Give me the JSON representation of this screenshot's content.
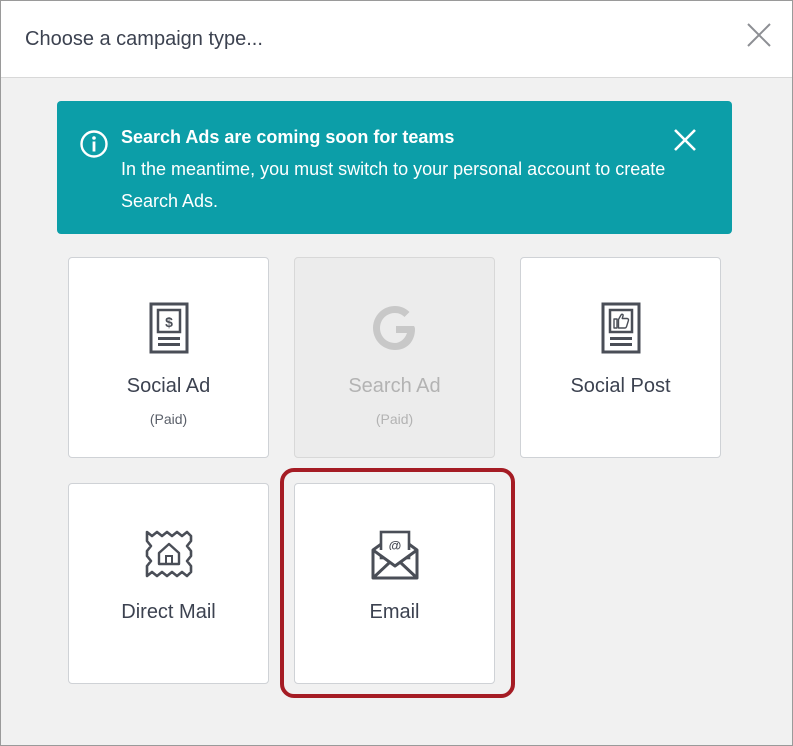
{
  "dialog": {
    "title": "Choose a campaign type..."
  },
  "banner": {
    "title": "Search Ads are coming soon for teams",
    "body": "In the meantime, you must switch to your personal account to create Search Ads.",
    "color": "#0c9ea8"
  },
  "cards": [
    {
      "label": "Social Ad",
      "sub": "(Paid)",
      "icon": "social-ad-icon",
      "disabled": false
    },
    {
      "label": "Search Ad",
      "sub": "(Paid)",
      "icon": "google-icon",
      "disabled": true
    },
    {
      "label": "Social Post",
      "sub": "",
      "icon": "social-post-icon",
      "disabled": false
    },
    {
      "label": "Direct Mail",
      "sub": "",
      "icon": "direct-mail-icon",
      "disabled": false
    },
    {
      "label": "Email",
      "sub": "",
      "icon": "email-icon",
      "disabled": false,
      "highlighted": true
    }
  ],
  "colors": {
    "highlight": "#a51c24",
    "icon": "#4a4e57",
    "disabled_icon": "#c8c8c8"
  }
}
